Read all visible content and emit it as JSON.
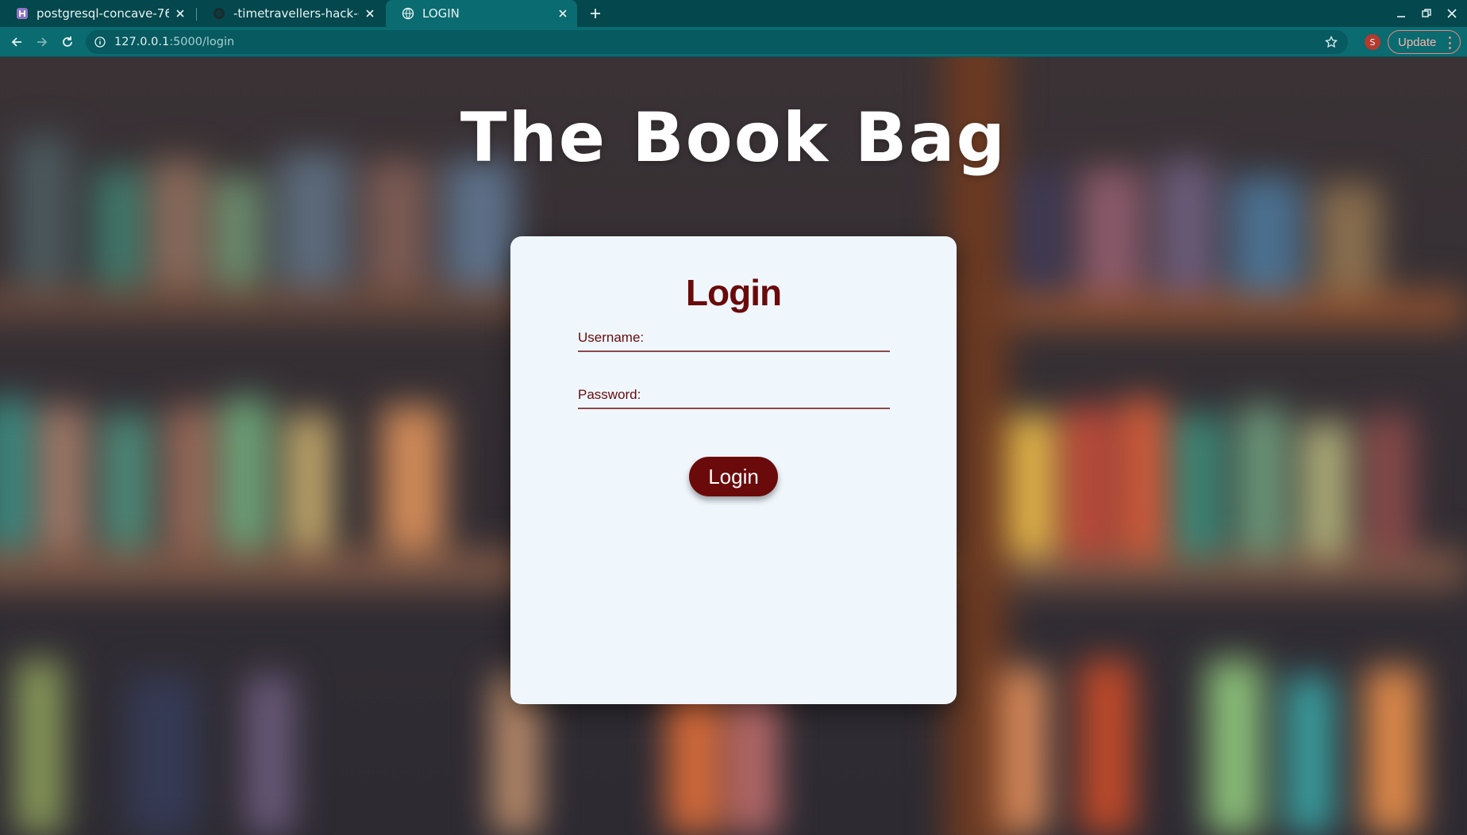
{
  "browser": {
    "tabs": [
      {
        "title": "postgresql-concave-7695...",
        "favicon": "heroku-h-icon",
        "active": false
      },
      {
        "title": "-timetravellers-hack-o-fie...",
        "favicon": "github-icon",
        "active": false
      },
      {
        "title": "LOGIN",
        "favicon": "globe-icon",
        "active": true
      }
    ],
    "url_host": "127.0.0.1",
    "url_path": ":5000/login",
    "profile_initial": "S",
    "update_label": "Update"
  },
  "page": {
    "brand_title": "The Book Bag",
    "login_title": "Login",
    "username_label": "Username:",
    "password_label": "Password:",
    "submit_label": "Login"
  },
  "colors": {
    "accent": "#6a0a0a",
    "card_bg": "#eff7fd",
    "browser_frame": "#0a6b70"
  }
}
